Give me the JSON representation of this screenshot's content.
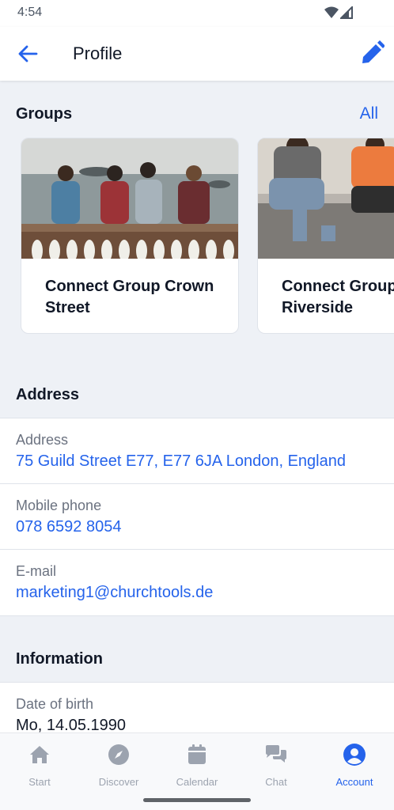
{
  "status_bar": {
    "time": "4:54"
  },
  "app_bar": {
    "title": "Profile"
  },
  "groups": {
    "title": "Groups",
    "all_label": "All",
    "cards": [
      {
        "title": "Connect Group Crown Street"
      },
      {
        "title": "Connect Group Riverside"
      }
    ]
  },
  "address_section": {
    "title": "Address",
    "rows": [
      {
        "label": "Address",
        "value": "75 Guild Street E77, E77 6JA London, England"
      },
      {
        "label": "Mobile phone",
        "value": "078 6592 8054"
      },
      {
        "label": "E-mail",
        "value": "marketing1@churchtools.de"
      }
    ]
  },
  "information_section": {
    "title": "Information",
    "rows": [
      {
        "label": "Date of birth",
        "value": "Mo, 14.05.1990"
      }
    ]
  },
  "nav": {
    "items": [
      {
        "label": "Start",
        "icon": "home-icon"
      },
      {
        "label": "Discover",
        "icon": "compass-icon"
      },
      {
        "label": "Calendar",
        "icon": "calendar-icon"
      },
      {
        "label": "Chat",
        "icon": "chat-icon"
      },
      {
        "label": "Account",
        "icon": "account-icon"
      }
    ],
    "active": "Account"
  },
  "colors": {
    "accent": "#2563eb",
    "background": "#eef1f6",
    "nav_inactive": "#9ca3af"
  }
}
